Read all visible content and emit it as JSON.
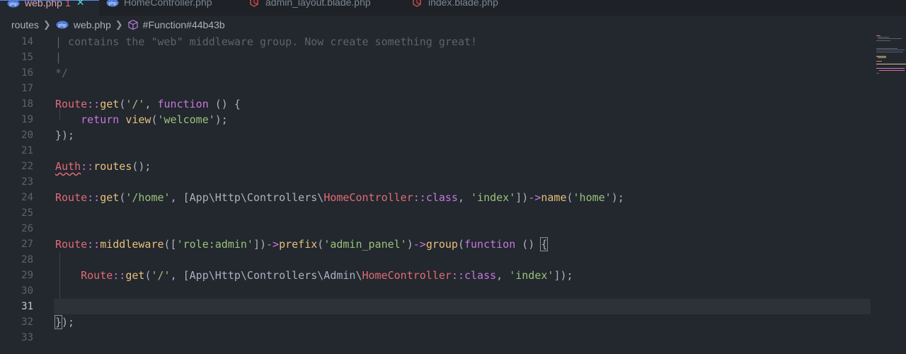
{
  "tabs": [
    {
      "name": "web.php",
      "count": "1",
      "icon": "php-icon",
      "active": true
    },
    {
      "name": "HomeController.php",
      "icon": "php-icon",
      "active": false
    },
    {
      "name": "admin_layout.blade.php",
      "icon": "laravel-icon",
      "active": false
    },
    {
      "name": "index.blade.php",
      "icon": "laravel-icon",
      "active": false
    }
  ],
  "breadcrumb": {
    "folder": "routes",
    "file": "web.php",
    "symbol": "#Function#44b43b"
  },
  "colors": {
    "background": "#23272e",
    "comment": "#5c6370",
    "class": "#e06c75",
    "function": "#e5c07b",
    "string": "#98c379",
    "keyword": "#c678dd"
  },
  "editor": {
    "current_line": "31",
    "lines": [
      {
        "num": "14",
        "text": "| contains the \"web\" middleware group. Now create something great!"
      },
      {
        "num": "15",
        "text": "|"
      },
      {
        "num": "16",
        "text": "*/"
      },
      {
        "num": "17",
        "text": ""
      },
      {
        "num": "18",
        "text": "Route::get('/', function () {"
      },
      {
        "num": "19",
        "text": "    return view('welcome');"
      },
      {
        "num": "20",
        "text": "});"
      },
      {
        "num": "21",
        "text": ""
      },
      {
        "num": "22",
        "text": "Auth::routes();"
      },
      {
        "num": "23",
        "text": ""
      },
      {
        "num": "24",
        "text": "Route::get('/home', [App\\Http\\Controllers\\HomeController::class, 'index'])->name('home');"
      },
      {
        "num": "25",
        "text": ""
      },
      {
        "num": "26",
        "text": ""
      },
      {
        "num": "27",
        "text": "Route::middleware(['role:admin'])->prefix('admin_panel')->group(function () {"
      },
      {
        "num": "28",
        "text": ""
      },
      {
        "num": "29",
        "text": "    Route::get('/', [App\\Http\\Controllers\\Admin\\HomeController::class, 'index']);"
      },
      {
        "num": "30",
        "text": ""
      },
      {
        "num": "31",
        "text": ""
      },
      {
        "num": "32",
        "text": "});"
      },
      {
        "num": "33",
        "text": ""
      }
    ]
  }
}
